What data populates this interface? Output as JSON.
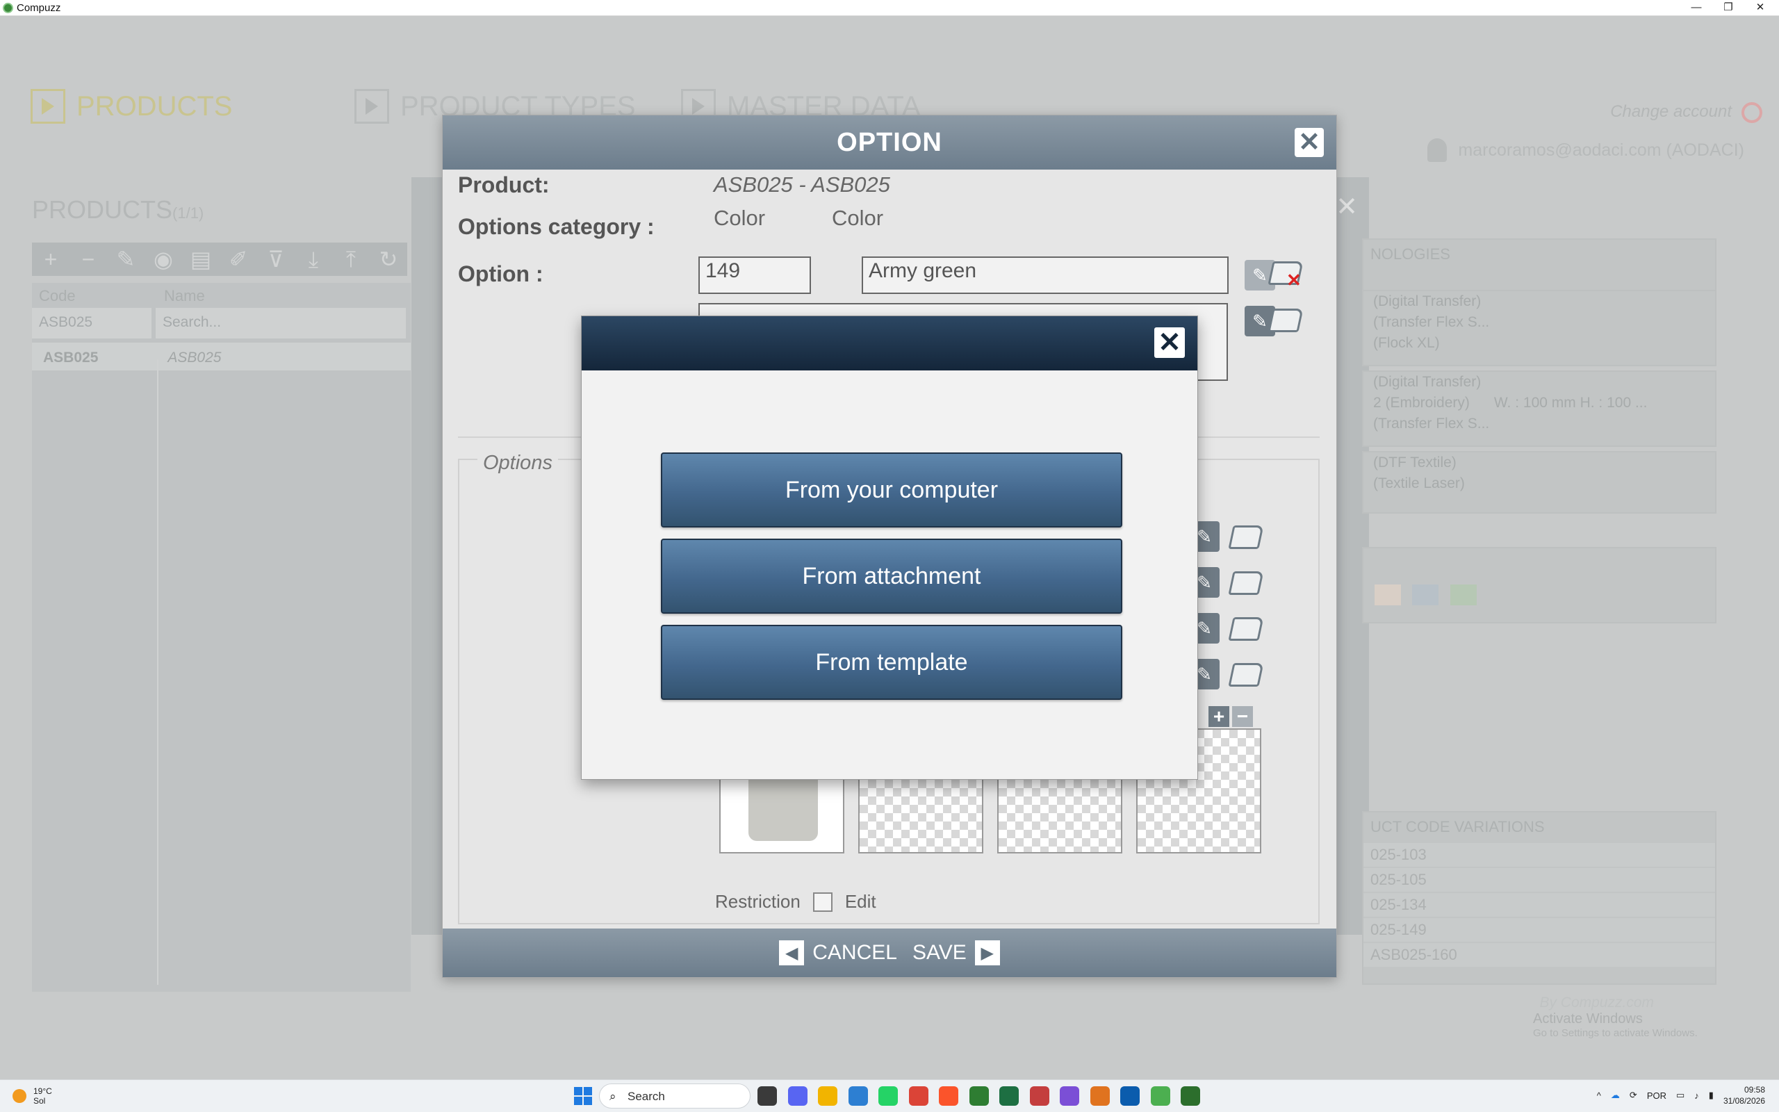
{
  "window": {
    "title": "Compuzz",
    "minimize": "—",
    "restore": "❐",
    "close": "✕"
  },
  "nav": {
    "products": "PRODUCTS",
    "product_types": "PRODUCT TYPES",
    "master_data": "MASTER DATA"
  },
  "account": {
    "change": "Change account",
    "user": "marcoramos@aodaci.com (AODACI)"
  },
  "products_panel": {
    "title": "PRODUCTS",
    "count": "(1/1)",
    "columns": [
      "Code",
      "Name"
    ],
    "filter_code": "ASB025",
    "filter_name": "Search...",
    "rows": [
      {
        "code": "ASB025",
        "name": "ASB025"
      }
    ]
  },
  "right_panel": {
    "technologies_header": "NOLOGIES",
    "tech_lines_1": [
      "(Digital Transfer)",
      "(Transfer Flex S...",
      "(Flock XL)"
    ],
    "tech_lines_2": [
      "(Digital Transfer)",
      "2 (Embroidery)",
      "(Transfer Flex S..."
    ],
    "tech_size": "W. : 100 mm H. : 100 ...",
    "tech_lines_3": [
      "(DTF Textile)",
      "(Textile Laser)"
    ],
    "variations_header": "UCT CODE VARIATIONS",
    "variations": [
      "025-103",
      "025-105",
      "025-134",
      "025-149",
      "ASB025-160"
    ],
    "swatch_colors": [
      "#d9cfc6",
      "#b8c1c8",
      "#b6c8b4"
    ],
    "by": "By Compuzz.com"
  },
  "activate": {
    "title": "Activate Windows",
    "sub": "Go to Settings to activate Windows."
  },
  "option_dialog": {
    "title": "OPTION",
    "close": "✕",
    "product_label": "Product:",
    "product_value": "ASB025 - ASB025",
    "category_label": "Options category :",
    "category_value_1": "Color",
    "category_value_2": "Color",
    "option_label": "Option :",
    "option_code": "149",
    "option_name": "Army green",
    "options_legend": "Options",
    "restriction_label": "Restriction",
    "edit_label": "Edit",
    "cancel": "CANCEL",
    "save": "SAVE",
    "plus": "+",
    "minus": "−"
  },
  "upload_modal": {
    "close": "✕",
    "buttons": [
      "From your computer",
      "From attachment",
      "From template"
    ]
  },
  "taskbar": {
    "temperature": "19°C",
    "condition": "Sol",
    "search": "Search",
    "language": "POR",
    "time": "09:58",
    "date": "31/08/2026",
    "icon_colors": [
      "#3a3a3a",
      "#5865f2",
      "#f2b400",
      "#2d7fd2",
      "#25d366",
      "#db4437",
      "#fb542b",
      "#2e7d32",
      "#1d6f42",
      "#c43e3e",
      "#7b4fd6",
      "#e0731f",
      "#0b5cad",
      "#4caf50",
      "#2c6e2c"
    ]
  }
}
